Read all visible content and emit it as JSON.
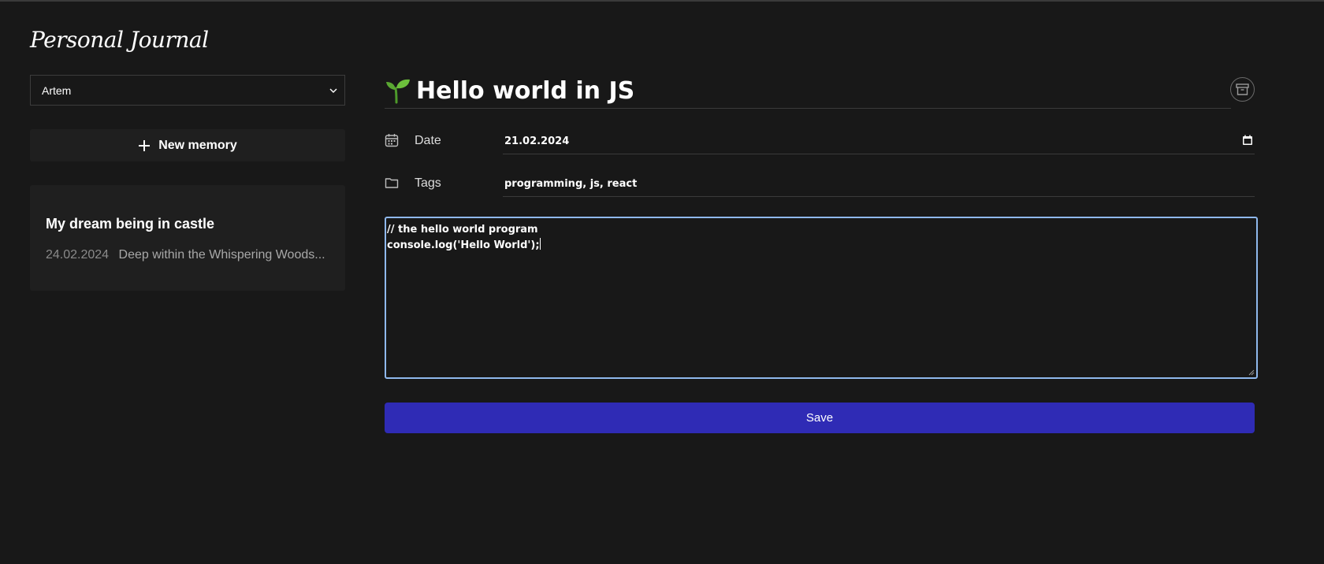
{
  "app": {
    "logo": "Personal Journal"
  },
  "sidebar": {
    "user_select": {
      "value": "Artem"
    },
    "new_memory_label": "New memory",
    "memories": [
      {
        "title": "My dream being in castle",
        "date": "24.02.2024",
        "excerpt": "Deep within the Whispering Woods..."
      }
    ]
  },
  "entry": {
    "title": "Hello world in JS",
    "date_label": "Date",
    "date_value": "21.02.2024",
    "tags_label": "Tags",
    "tags_value": "programming, js, react",
    "content_lines": [
      "// the hello world program",
      "console.log('Hello World');"
    ],
    "save_label": "Save"
  },
  "colors": {
    "background": "#181818",
    "panel": "#1f1f1f",
    "accent": "#2f2bb5",
    "focus_border": "#8fb8ec",
    "sprout": "#5aa832"
  },
  "icons": [
    "chevron-down-icon",
    "plus-icon",
    "sprout-icon",
    "archive-icon",
    "calendar-icon",
    "folder-icon"
  ]
}
